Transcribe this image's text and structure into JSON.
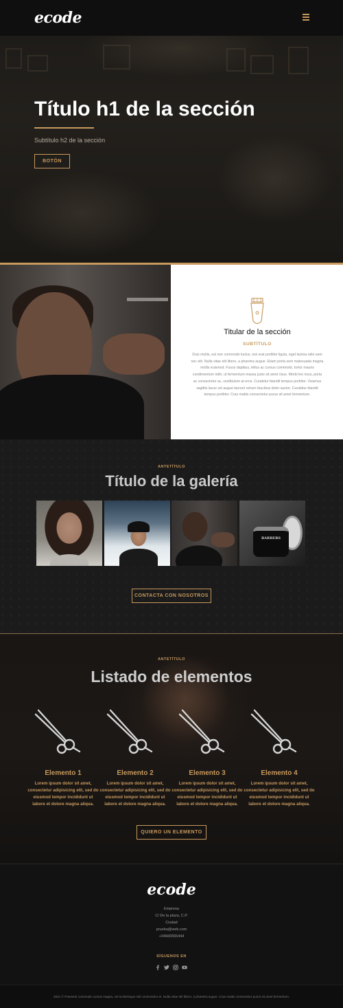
{
  "header": {
    "logo": "ecode",
    "menu_icon": "hamburger-menu-icon"
  },
  "hero": {
    "title": "Título h1 de la sección",
    "subtitle": "Subtítulo h2 de la sección",
    "button": "BOTÓN"
  },
  "feature": {
    "icon": "hair-clipper-icon",
    "title": "Titular de la sección",
    "subtitle": "SUBTÍTULO",
    "body": "Duis mollis, est non commodo luctus, nisi erat porttitor ligula, eget lacinia odio sem nec elit. Nulla vitae elit libero, a pharetra augue. Etiam porta sem malesuada magna mollis euismod. Fusce dapibus, tellus ac cursus commodo, tortor mauris condimentum nibh, ut fermentum massa justo sit amet risus. Morbi leo risus, porta ac consectetur ac, vestibulum at eros. Curabitur blandit tempus porttitor. Vivamus sagittis lacus vel augue laoreet rutrum faucibus dolor auctor. Curabitur blandit tempus porttitor. Cras mattis consectetur purus sit amet fermentum."
  },
  "gallery": {
    "eyebrow": "ANTETÍTULO",
    "title": "Título de la galería",
    "product_label": "BARBERS",
    "button": "CONTACTA CON NOSOTROS"
  },
  "elements": {
    "eyebrow": "ANTETÍTULO",
    "title": "Listado de elementos",
    "items": [
      {
        "title": "Elemento 1",
        "text": "Lorem ipsum dolor sit amet, consectetur adipisicing elit, sed do eiusmod tempor incididunt ut labore et dolore magna aliqua.",
        "icon": "scissors-icon"
      },
      {
        "title": "Elemento 2",
        "text": "Lorem ipsum dolor sit amet, consectetur adipisicing elit, sed do eiusmod tempor incididunt ut labore et dolore magna aliqua.",
        "icon": "scissors-icon"
      },
      {
        "title": "Elemento 3",
        "text": "Lorem ipsum dolor sit amet, consectetur adipisicing elit, sed do eiusmod tempor incididunt ut labore et dolore magna aliqua.",
        "icon": "scissors-icon"
      },
      {
        "title": "Elemento 4",
        "text": "Lorem ipsum dolor sit amet, consectetur adipisicing elit, sed do eiusmod tempor incididunt ut labore et dolore magna aliqua.",
        "icon": "scissors-icon"
      }
    ],
    "button": "QUIERO UN ELEMENTO"
  },
  "footer": {
    "logo": "ecode",
    "company": "Empresa",
    "address": "C/ De la plaza, C.P.",
    "city": "Ciudad",
    "email": "prueba@web.com",
    "phone": "+34666555444",
    "follow": "SÍGUENOS EN",
    "social_icons": [
      "facebook-icon",
      "twitter-icon",
      "instagram-icon",
      "youtube-icon"
    ],
    "copyright": "2021 © Praesent commodo cursus magna, vel scelerisque nisl consectetur et. Nulla vitae elit libero, a pharetra augue. Cras mattis consectetur purus sit amet fermentum."
  },
  "colors": {
    "accent": "#c89a5e",
    "background": "#161616",
    "white": "#ffffff"
  }
}
